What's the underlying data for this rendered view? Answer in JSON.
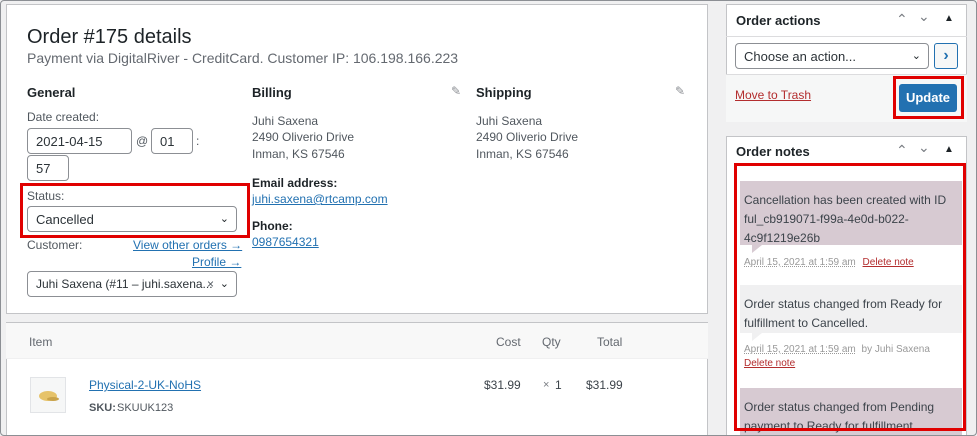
{
  "order": {
    "title": "Order #175 details",
    "subtitle": "Payment via DigitalRiver - CreditCard. Customer IP: 106.198.166.223"
  },
  "general": {
    "heading": "General",
    "date_label": "Date created:",
    "date_value": "2021-04-15",
    "at": "@",
    "hour": "01",
    "colon": ":",
    "minute": "57",
    "status_label": "Status:",
    "status_value": "Cancelled",
    "customer_label": "Customer:",
    "view_other_orders": "View other orders →",
    "profile": "Profile →",
    "customer_value": "Juhi Saxena (#11 – juhi.saxena...",
    "clear": "×"
  },
  "billing": {
    "heading": "Billing",
    "name": "Juhi Saxena",
    "street": "2490 Oliverio Drive",
    "city": "Inman, KS 67546",
    "email_label": "Email address:",
    "email": "juhi.saxena@rtcamp.com",
    "phone_label": "Phone:",
    "phone": "0987654321"
  },
  "shipping": {
    "heading": "Shipping",
    "name": "Juhi Saxena",
    "street": "2490 Oliverio Drive",
    "city": "Inman, KS 67546"
  },
  "items_table": {
    "headers": [
      "Item",
      "Cost",
      "Qty",
      "Total"
    ],
    "rows": [
      {
        "name": "Physical-2-UK-NoHS",
        "sku_label": "SKU:",
        "sku": "SKUUK123",
        "cost": "$31.99",
        "qty_x": "×",
        "qty": "1",
        "total": "$31.99"
      }
    ]
  },
  "order_actions": {
    "heading": "Order actions",
    "select_value": "Choose an action...",
    "go": "›",
    "trash": "Move to Trash",
    "update": "Update"
  },
  "order_notes": {
    "heading": "Order notes",
    "notes": [
      {
        "text": "Cancellation has been created with ID ful_cb919071-f99a-4e0d-b022-4c9f1219e26b",
        "date": "April 15, 2021 at 1:59 am",
        "by": "",
        "delete": "Delete note"
      },
      {
        "text": "Order status changed from Ready for fulfillment to Cancelled.",
        "date": "April 15, 2021 at 1:59 am",
        "by": "by Juhi Saxena",
        "delete": "Delete note"
      },
      {
        "text": "Order status changed from Pending payment to Ready for fulfillment.",
        "date": "",
        "by": "",
        "delete": ""
      }
    ]
  },
  "colors": {
    "accent": "#2271b1",
    "highlight": "#e00000",
    "system_note": "#d7cad2",
    "delete": "#b32d2e"
  },
  "icons": {
    "edit": "pencil-icon",
    "collapse": "chevron-up-icon",
    "expand": "chevron-down-icon",
    "toggle": "triangle-up-icon"
  }
}
